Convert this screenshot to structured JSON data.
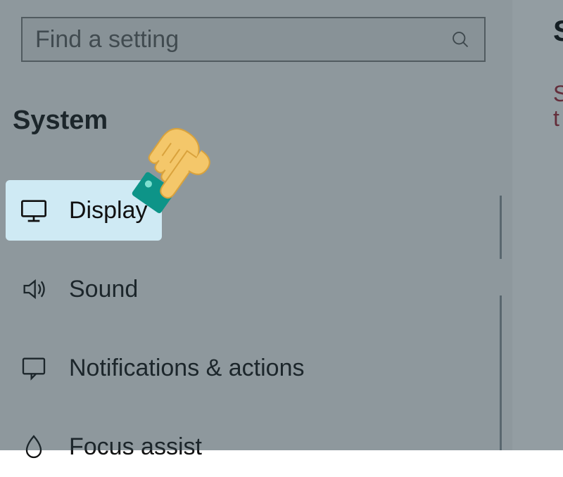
{
  "search": {
    "placeholder": "Find a setting"
  },
  "section": {
    "title": "System"
  },
  "nav": {
    "display": {
      "label": "Display"
    },
    "sound": {
      "label": "Sound"
    },
    "notifications": {
      "label": "Notifications & actions"
    },
    "focus": {
      "label": "Focus assist"
    }
  },
  "partial": {
    "s1": "S",
    "s2": "S",
    "s3": "t"
  }
}
